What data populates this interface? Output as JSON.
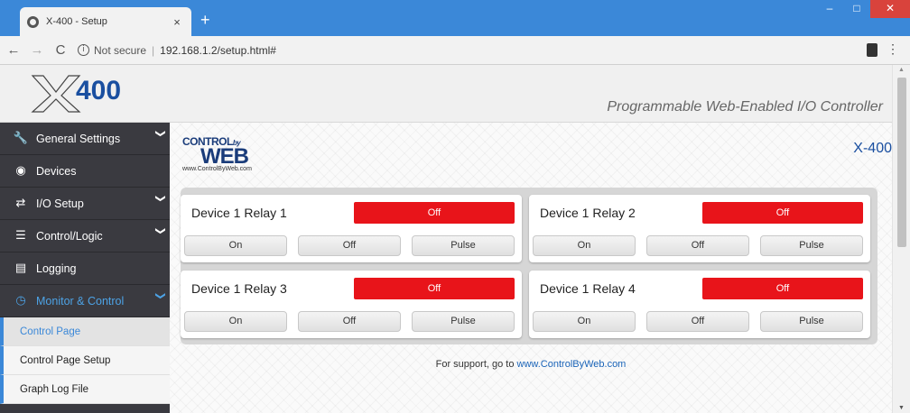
{
  "browser": {
    "tab_title": "X-400 - Setup",
    "tab_close": "×",
    "new_tab": "+",
    "security": "Not secure",
    "url": "192.168.1.2/setup.html#",
    "window_controls": [
      "–",
      "□",
      "✕"
    ]
  },
  "header": {
    "logo_text": "X400",
    "tagline": "Programmable Web-Enabled I/O Controller"
  },
  "sidebar": {
    "items": [
      {
        "label": "General Settings",
        "icon": "wrench-icon",
        "expandable": true
      },
      {
        "label": "Devices",
        "icon": "globe-icon",
        "expandable": false
      },
      {
        "label": "I/O Setup",
        "icon": "arrows-icon",
        "expandable": true
      },
      {
        "label": "Control/Logic",
        "icon": "server-icon",
        "expandable": true
      },
      {
        "label": "Logging",
        "icon": "bar-chart-icon",
        "expandable": false
      },
      {
        "label": "Monitor & Control",
        "icon": "gauge-icon",
        "expandable": true,
        "open": true
      }
    ],
    "subitems": [
      {
        "label": "Control Page",
        "active": true
      },
      {
        "label": "Control Page Setup",
        "active": false
      },
      {
        "label": "Graph Log File",
        "active": false
      }
    ]
  },
  "content": {
    "brand_line1": "CONTROL",
    "brand_by": "by",
    "brand_line2": "WEB",
    "brand_url": "www.ControlByWeb.com",
    "model": "X-400",
    "relays": [
      {
        "name": "Device 1 Relay 1",
        "state": "Off",
        "buttons": [
          "On",
          "Off",
          "Pulse"
        ]
      },
      {
        "name": "Device 1 Relay 2",
        "state": "Off",
        "buttons": [
          "On",
          "Off",
          "Pulse"
        ]
      },
      {
        "name": "Device 1 Relay 3",
        "state": "Off",
        "buttons": [
          "On",
          "Off",
          "Pulse"
        ]
      },
      {
        "name": "Device 1 Relay 4",
        "state": "Off",
        "buttons": [
          "On",
          "Off",
          "Pulse"
        ]
      }
    ],
    "support_text": "For support, go to ",
    "support_link": "www.ControlByWeb.com"
  },
  "colors": {
    "accent": "#3b88d8",
    "relay_off": "#e8141a",
    "sidebar_bg": "#3a3a40"
  }
}
